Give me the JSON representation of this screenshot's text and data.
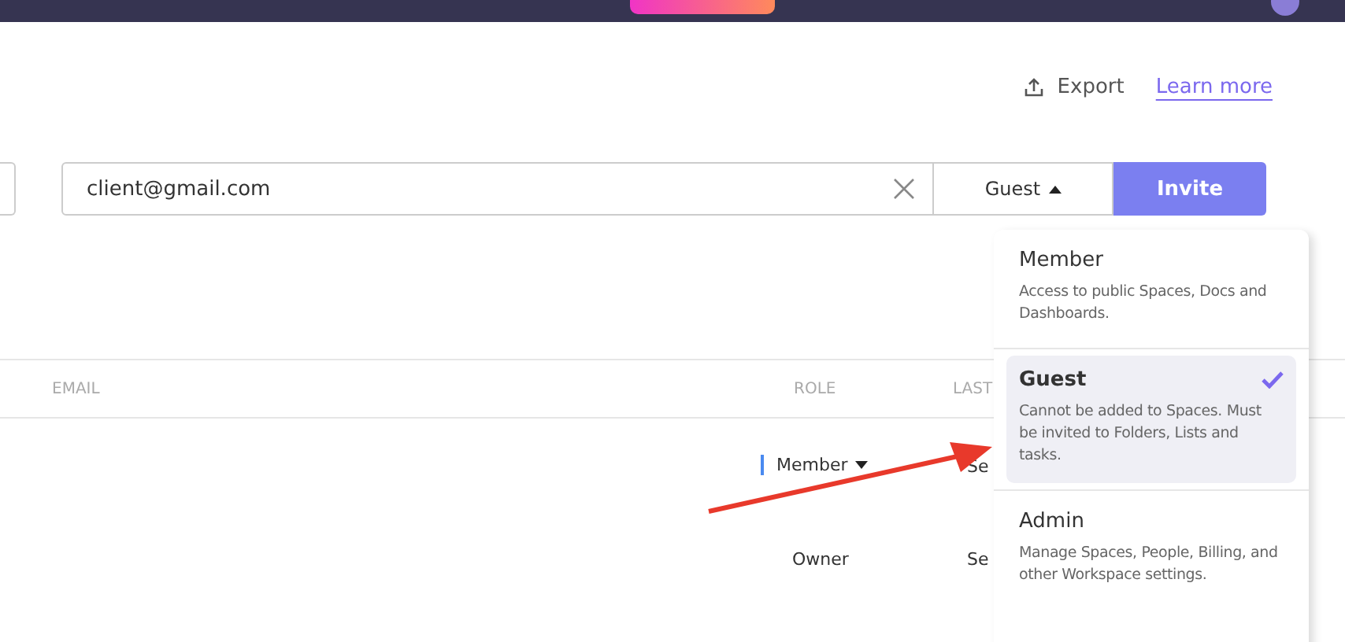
{
  "header": {
    "actions": [
      {
        "kind": "export",
        "label": "Export"
      },
      {
        "kind": "link",
        "label": "Learn more"
      }
    ]
  },
  "invite": {
    "email": "client@gmail.com",
    "role": "Guest",
    "open": true,
    "button": "Invite"
  },
  "table": {
    "columns": [
      "EMAIL",
      "ROLE",
      "LAST"
    ],
    "rows": [
      {
        "role": "Member",
        "editable": true,
        "column_3": "Se"
      },
      {
        "role": "Owner",
        "editable": false,
        "column_3": "Se"
      }
    ]
  },
  "role_menu": [
    {
      "title": "Member",
      "description": "Access to public Spaces, Docs and Dashboards.",
      "selected": false
    },
    {
      "title": "Guest",
      "description": "Cannot be added to Spaces. Must be invited to Folders, Lists and tasks.",
      "selected": true
    },
    {
      "title": "Admin",
      "description": "Manage Spaces, People, Billing, and other Workspace settings.",
      "selected": false
    }
  ]
}
